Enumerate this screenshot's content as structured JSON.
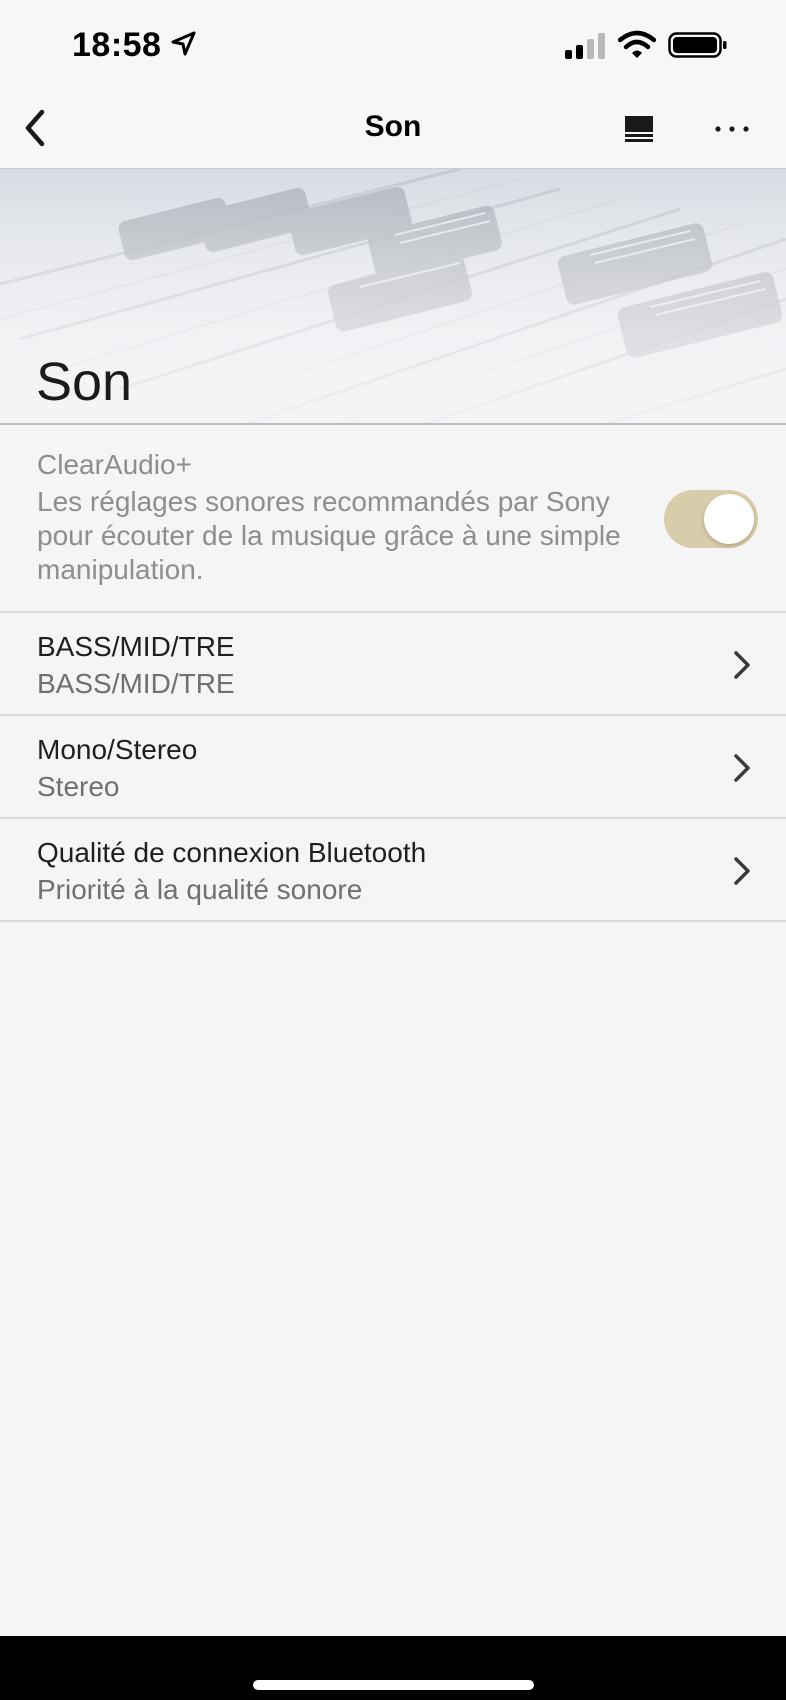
{
  "status_bar": {
    "time": "18:58",
    "icons": [
      "location-arrow-icon",
      "cellular-signal-icon",
      "wifi-icon",
      "battery-icon"
    ]
  },
  "nav": {
    "title": "Son",
    "left_icon": "chevron-left-icon",
    "right_icons": [
      "list-icon",
      "more-icon"
    ]
  },
  "hero": {
    "title": "Son"
  },
  "clearaudio": {
    "title": "ClearAudio+",
    "description": "Les réglages sonores recommandés par Sony pour écouter de la musique grâce à une simple manipulation.",
    "toggle_on": true,
    "toggle_color": "#d8ccaa",
    "state": "disabled"
  },
  "settings": [
    {
      "title": "BASS/MID/TRE",
      "value": "BASS/MID/TRE"
    },
    {
      "title": "Mono/Stereo",
      "value": "Stereo"
    },
    {
      "title": "Qualité de connexion Bluetooth",
      "value": "Priorité à la qualité sonore"
    }
  ],
  "colors": {
    "background": "#f5f5f5",
    "divider": "#dadada",
    "muted_text": "#8e8e8e"
  }
}
